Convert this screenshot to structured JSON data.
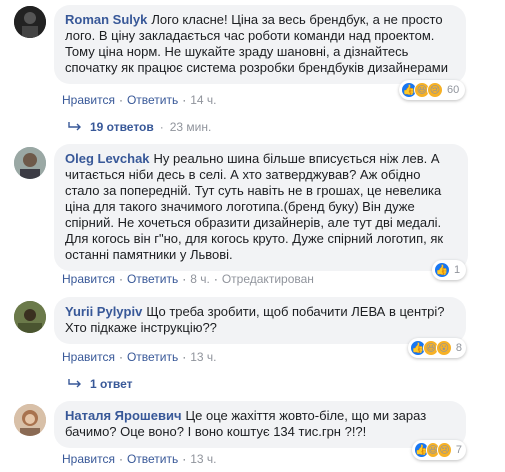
{
  "comments": [
    {
      "author": "Roman Sulyk",
      "text": "Лого класне! Ціна за весь брендбук, а не просто лого. В ціну закладається час роботи команди над проектом. Тому ціна норм. Не шукайте зраду шановні, а дізнайтесь спочатку як працює система розробки брендбуків дизайнерами",
      "like_label": "Нравится",
      "reply_label": "Ответить",
      "time": "14 ч.",
      "reaction_count": "60",
      "replies_label": "19 ответов",
      "replies_time": "23 мин."
    },
    {
      "author": "Oleg Levchak",
      "text": "Ну реально шина більше вписується ніж лев. А читається ніби десь в селі. А хто затверджував? Аж обідно стало за попередній. Тут суть навіть не в грошах, це невелика ціна для такого значимого логотипа.(бренд буку) Він дуже спірний. Не хочеться образити дизайнерів, але тут дві медалі. Для когось він г\"но, для когось круто. Дуже спірний логотип, як останні памятники у Львові.",
      "like_label": "Нравится",
      "reply_label": "Ответить",
      "time": "8 ч.",
      "edited": "Отредактирован",
      "reaction_count": "1"
    },
    {
      "author": "Yurii Pylypiv",
      "text": "Що треба зробити, щоб побачити ЛЕВА в центрі? Хто підкаже інструкцію??",
      "like_label": "Нравится",
      "reply_label": "Ответить",
      "time": "13 ч.",
      "reaction_count": "8",
      "replies_label": "1 ответ"
    },
    {
      "author": "Наталя Ярошевич",
      "text": "Це оце жахіття жовто-біле, що ми зараз бачимо? Оце воно? І воно коштує 134 тис.грн ?!?!",
      "like_label": "Нравится",
      "reply_label": "Ответить",
      "time": "13 ч.",
      "reaction_count": "7"
    }
  ],
  "colors": {
    "link": "#385898",
    "bubble": "#f2f3f5",
    "like": "#1877f2",
    "emoji": "#f7b125"
  }
}
